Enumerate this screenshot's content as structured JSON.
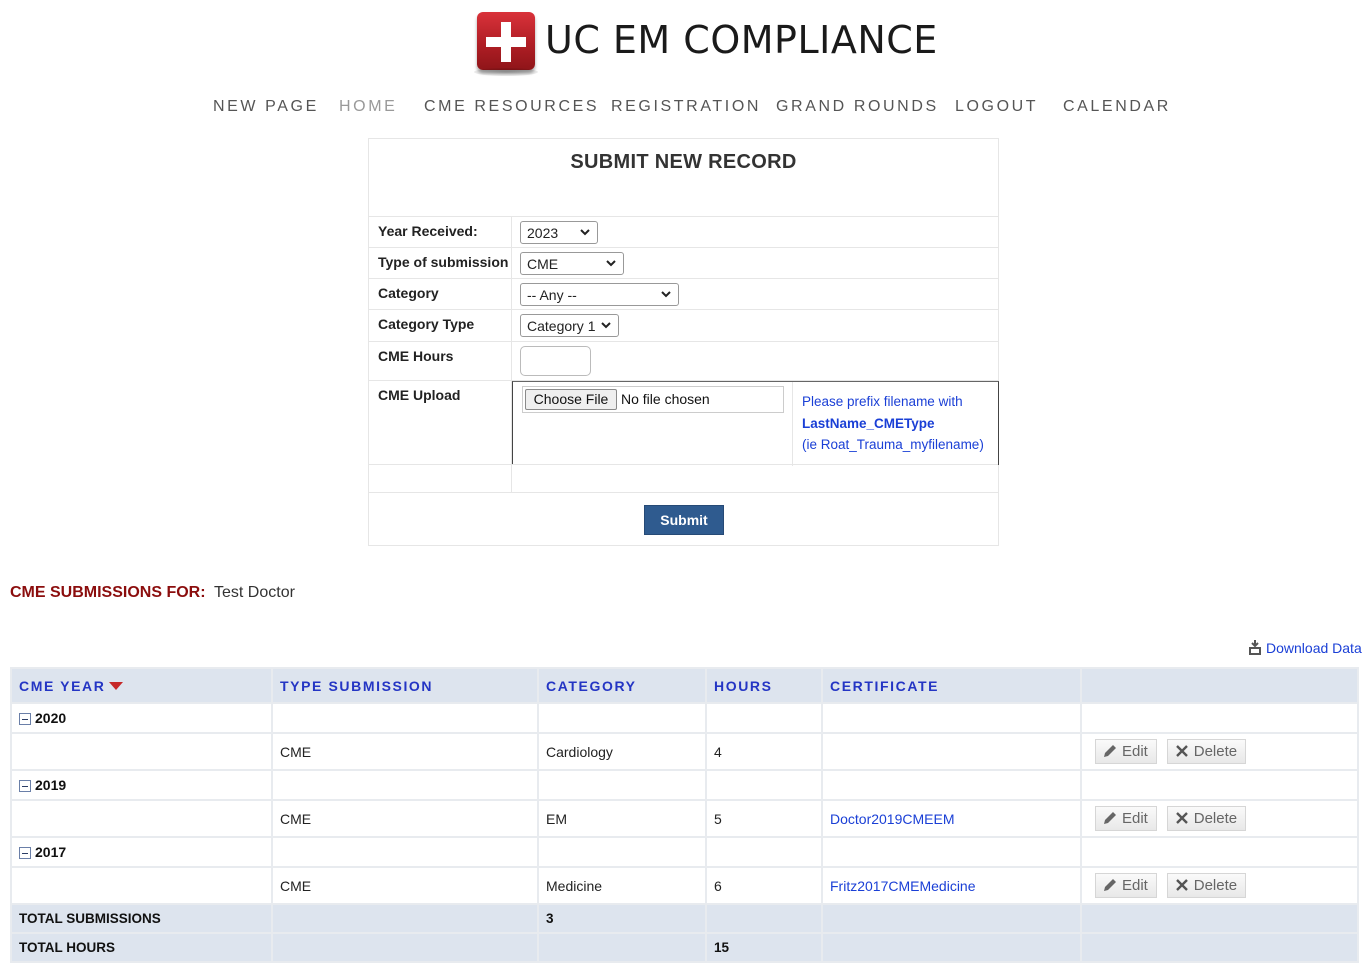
{
  "site": {
    "title": "UC EM COMPLIANCE",
    "logo_icon": "medical-cross-icon",
    "logo_color": "#c1272d"
  },
  "nav": {
    "items": [
      {
        "label": "NEW PAGE",
        "active": false
      },
      {
        "label": "HOME",
        "active": true
      },
      {
        "label": "CME RESOURCES",
        "active": false
      },
      {
        "label": "REGISTRATION",
        "active": false
      },
      {
        "label": "GRAND ROUNDS",
        "active": false
      },
      {
        "label": "LOGOUT",
        "active": false
      },
      {
        "label": "CALENDAR",
        "active": false
      }
    ]
  },
  "form": {
    "title": "SUBMIT NEW RECORD",
    "year_label": "Year Received:",
    "year_value": "2023",
    "type_label": "Type of submission",
    "type_value": "CME",
    "category_label": "Category",
    "category_value": "-- Any --",
    "category_type_label": "Category Type",
    "category_type_value": "Category 1",
    "hours_label": "CME Hours",
    "hours_value": "",
    "upload_label": "CME Upload",
    "choose_file": "Choose File",
    "no_file": "No file chosen",
    "note_line1": "Please prefix filename with",
    "note_line2": "LastName_CMEType",
    "note_line3": "(ie Roat_Trauma_myfilename)",
    "submit": "Submit"
  },
  "submissions": {
    "label": "CME SUBMISSIONS FOR:",
    "user": "Test Doctor",
    "download": "Download Data",
    "columns": [
      "CME YEAR",
      "TYPE SUBMISSION",
      "CATEGORY",
      "HOURS",
      "CERTIFICATE"
    ],
    "groups": [
      {
        "year": "2020",
        "row": {
          "type": "CME",
          "category": "Cardiology",
          "hours": "4",
          "certificate": ""
        }
      },
      {
        "year": "2019",
        "row": {
          "type": "CME",
          "category": "EM",
          "hours": "5",
          "certificate": "Doctor2019CMEEM"
        }
      },
      {
        "year": "2017",
        "row": {
          "type": "CME",
          "category": "Medicine",
          "hours": "6",
          "certificate": "Fritz2017CMEMedicine"
        }
      }
    ],
    "edit_label": "Edit",
    "delete_label": "Delete",
    "total_submissions_label": "TOTAL SUBMISSIONS",
    "total_submissions": "3",
    "total_hours_label": "TOTAL HOURS",
    "total_hours": "15"
  },
  "colors": {
    "link": "#1a3fd6",
    "header_bg": "#dde4ee",
    "submit_bg": "#2f5b8f",
    "label_red": "#8b0d0d",
    "sort_arrow": "#c62828"
  }
}
